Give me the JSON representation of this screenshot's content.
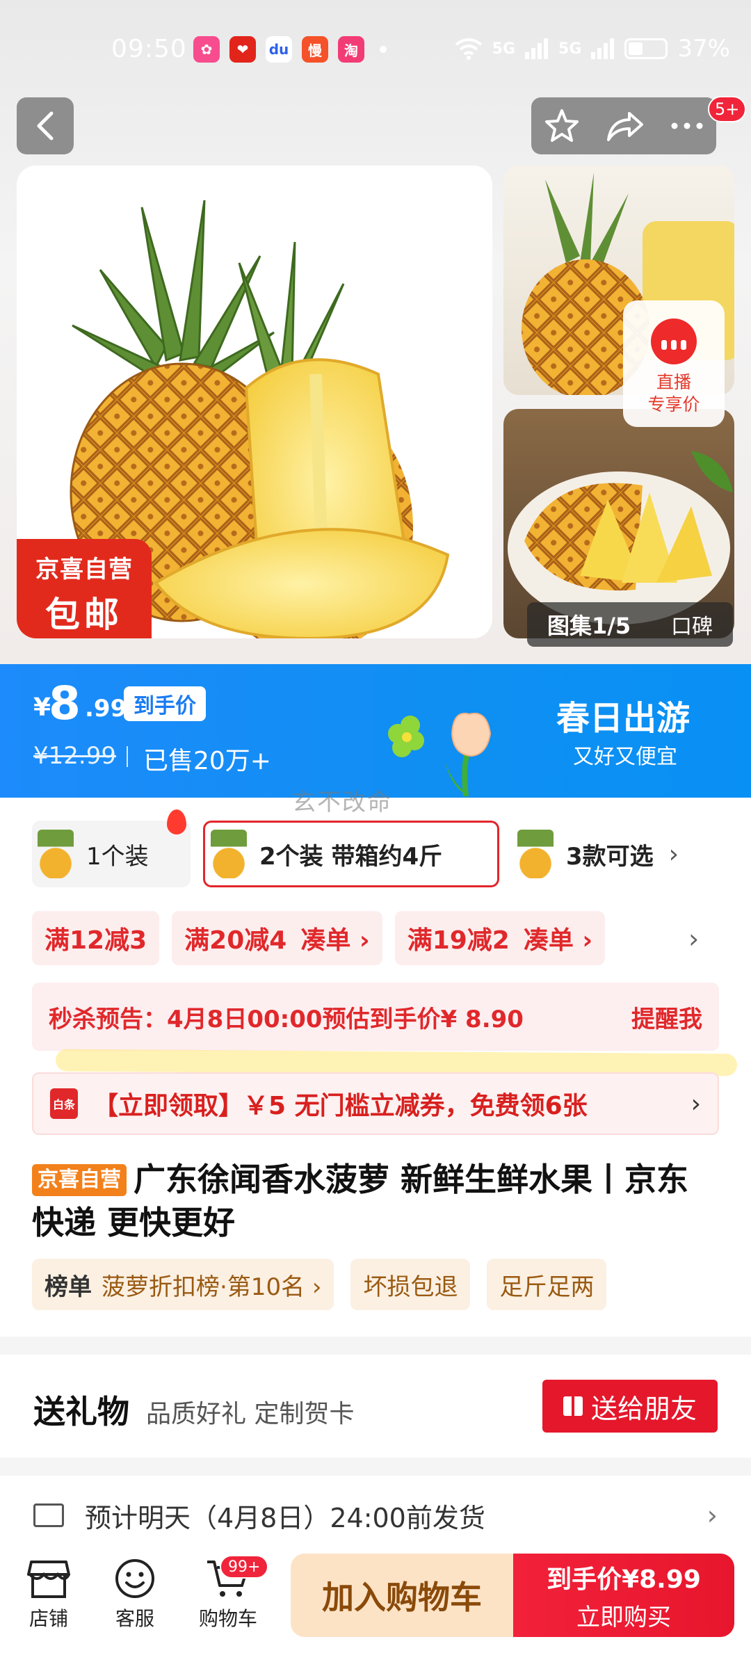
{
  "status_bar": {
    "time": "09:50",
    "battery": "37%",
    "signal_1": "5G",
    "signal_2": "5G",
    "app_icons": [
      "taobao-icon-pink",
      "jd-icon",
      "baidu-icon",
      "manman-icon",
      "tao-icon"
    ]
  },
  "header": {
    "cart_badge": "5+"
  },
  "gallery": {
    "main_badge_line1": "京喜自营",
    "main_badge_line2": "包邮",
    "live_title": "直播",
    "live_subtitle": "专享价",
    "gallery_counter": "图集1/5",
    "koubei": "口碑"
  },
  "price_banner": {
    "currency": "¥",
    "price_int": "8",
    "price_dec": ".99",
    "price_tag": "到手价",
    "original_price": "¥12.99",
    "sold": "已售20万+",
    "campaign_title": "春日出游",
    "campaign_subtitle": "又好又便宜",
    "watermark": "玄不改命",
    "colors": {
      "banner": "#1d8bfb"
    }
  },
  "variants": [
    {
      "label": "1个装"
    },
    {
      "label": "2个装 带箱约4斤"
    },
    {
      "label": "3款可选"
    }
  ],
  "promos": [
    {
      "label": "满12减3",
      "suffix": ""
    },
    {
      "label": "满20减4",
      "suffix": "凑单 ›"
    },
    {
      "label": "满19减2",
      "suffix": "凑单 ›"
    }
  ],
  "flash_sale": {
    "text": "秒杀预告：4月8日00:00预估到手价¥ 8.90",
    "action": "提醒我"
  },
  "coupon": {
    "icon_text": "白条",
    "text": "【立即领取】￥5 无门槛立减券，免费领6张"
  },
  "product": {
    "tag": "京喜自营",
    "title": "广东徐闻香水菠萝 新鲜生鲜水果丨京东快递 更快更好"
  },
  "tags": {
    "rank_label": "榜单",
    "rank_text": "菠萝折扣榜·第10名 ›",
    "tag2": "坏损包退",
    "tag3": "足斤足两"
  },
  "gift": {
    "title": "送礼物",
    "subtitle": "品质好礼 定制贺卡",
    "button": "送给朋友"
  },
  "shipping": {
    "text": "预计明天（4月8日）24:00前发货"
  },
  "bottom_bar": {
    "store": "店铺",
    "service": "客服",
    "cart": "购物车",
    "cart_badge": "99+",
    "add_to_cart": "加入购物车",
    "buy_line1": "到手价¥8.99",
    "buy_line2": "立即购买"
  }
}
